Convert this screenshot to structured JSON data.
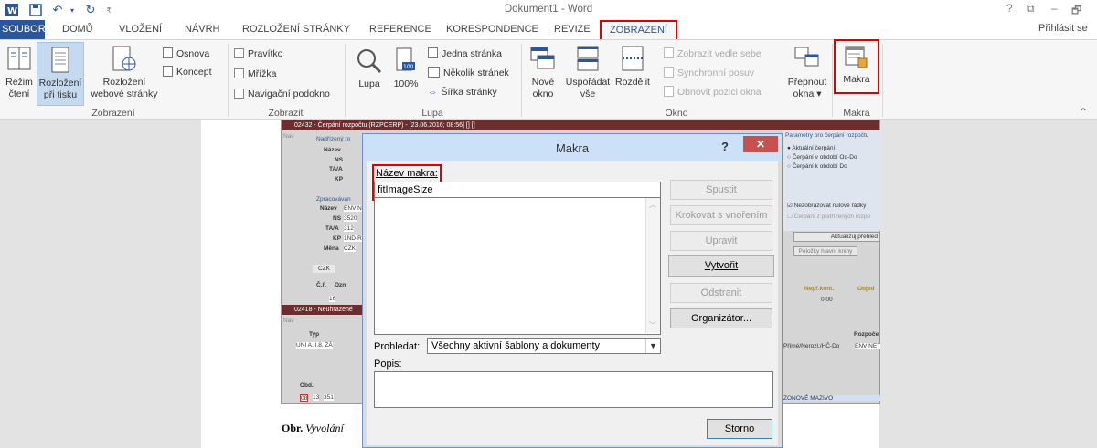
{
  "window": {
    "title": "Dokument1 - Word",
    "signin": "Přihlásit se",
    "help": "?",
    "minimize": "–",
    "restore": "⧉",
    "close": "✕"
  },
  "tabs": [
    "SOUBOR",
    "DOMŮ",
    "VLOŽENÍ",
    "NÁVRH",
    "ROZLOŽENÍ STRÁNKY",
    "REFERENCE",
    "KORESPONDENCE",
    "REVIZE",
    "ZOBRAZENÍ"
  ],
  "ribbon": {
    "zobrazeni": {
      "label": "Zobrazení",
      "rezim1": "Režim",
      "rezim2": "čtení",
      "rozlozeni1": "Rozložení",
      "rozlozeni2": "při tisku",
      "web1": "Rozložení",
      "web2": "webové stránky",
      "osnova": "Osnova",
      "koncept": "Koncept"
    },
    "zobrazit": {
      "label": "Zobrazit",
      "pravitko": "Pravítko",
      "mrizka": "Mřížka",
      "navigace": "Navigační podokno"
    },
    "lupa": {
      "label": "Lupa",
      "lupa": "Lupa",
      "pct": "100%",
      "jedna": "Jedna stránka",
      "nekolik": "Několik stránek",
      "sirka": "Šířka stránky"
    },
    "okno": {
      "label": "Okno",
      "nove1": "Nové",
      "nove2": "okno",
      "usporadat1": "Uspořádat",
      "usporadat2": "vše",
      "rozdelit": "Rozdělit",
      "vedle": "Zobrazit vedle sebe",
      "posuv": "Synchronní posuv",
      "obnovit": "Obnovit pozici okna",
      "prepnout1": "Přepnout",
      "prepnout2": "okna ▾"
    },
    "makra": {
      "label": "Makra",
      "makra": "Makra"
    },
    "collapse": "⌃"
  },
  "document": {
    "caption_bold": "Obr.",
    "caption_italic": "Vyvolání"
  },
  "app_shot": {
    "hdr1": "02432 - Čerpání rozpočtu (RZPCERP) - [23.06.2016; 08:56] [] []",
    "hdr2": "02418 - Neuhrazené",
    "nav": "Nav",
    "nadrizeny": "Nadřízený ro",
    "f_nazev": "Název",
    "f_ns": "NS",
    "f_taa": "TA/A",
    "f_kp": "KP",
    "zpracovavany": "Zpracovávan",
    "v_nazev": "ENVIN",
    "v_ns": "3520",
    "v_taa": "312",
    "v_kp": "1ND-R",
    "mena": "Měna",
    "v_mena": "CZK",
    "czk": "CZK",
    "cislo": "Č.ř.",
    "ozn": "Ozn",
    "row1": "16",
    "typ": "Typ",
    "typ_val": "UNI A.II.8. ZÁ",
    "obd": "Obd.",
    "obd_val": "08",
    "obd_13": "13",
    "obd_351": "351",
    "param_title": "Parametry pro čerpání rozpočtu",
    "radio1": "Aktuální čerpání",
    "radio2": "Čerpání v období Od-Do",
    "radio3": "Čerpání k období Do",
    "chk1": "Nezobrazovat nulové řádky",
    "chk2": "Čerpání z podřízených rozpo",
    "btn_aktual": "Aktualizuj přehled",
    "btn_knihy": "Položky hlavní knihy",
    "nepr": "Nepř.kont.",
    "obje": "Objed",
    "nepr_val": "0.00",
    "rozpoc": "Rozpoče",
    "prime": "Přímé/Nerozl./HČ-Do",
    "envinet": "ENVINET",
    "mazivo": "ZONOVÉ MAZIVO"
  },
  "dialog": {
    "title": "Makra",
    "help": "?",
    "close": "✕",
    "name_label": "Název makra:",
    "name_value": "fitImageSize",
    "buttons": {
      "spustit": "Spustit",
      "krokovat": "Krokovat s vnořením",
      "upravit": "Upravit",
      "vytvorit": "Vytvořit",
      "odstranit": "Odstranit",
      "organizator": "Organizátor...",
      "storno": "Storno"
    },
    "prohledat_label": "Prohledat:",
    "prohledat_value": "Všechny aktivní šablony a dokumenty",
    "popis_label": "Popis:"
  }
}
